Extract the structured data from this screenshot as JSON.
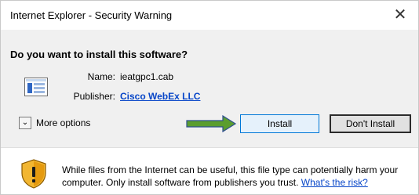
{
  "window": {
    "title": "Internet Explorer - Security Warning",
    "close_glyph": "✕"
  },
  "prompt": {
    "heading": "Do you want to install this software?"
  },
  "file": {
    "icon": "cab-file-icon",
    "name_label": "Name:",
    "name_value": "ieatgpc1.cab",
    "publisher_label": "Publisher:",
    "publisher_value": "Cisco WebEx LLC"
  },
  "options": {
    "toggle_glyph": "⌄",
    "label": "More options"
  },
  "buttons": {
    "install": "Install",
    "dont_install": "Don't Install"
  },
  "annotation": {
    "arrow_color": "#5b9e2e",
    "arrow_outline": "#2f4f8f"
  },
  "warning": {
    "icon": "shield-warning-icon",
    "text_part1": "While files from the Internet can be useful, this file type can potentially harm your computer. Only install software from publishers you trust. ",
    "link": "What's the risk?"
  }
}
